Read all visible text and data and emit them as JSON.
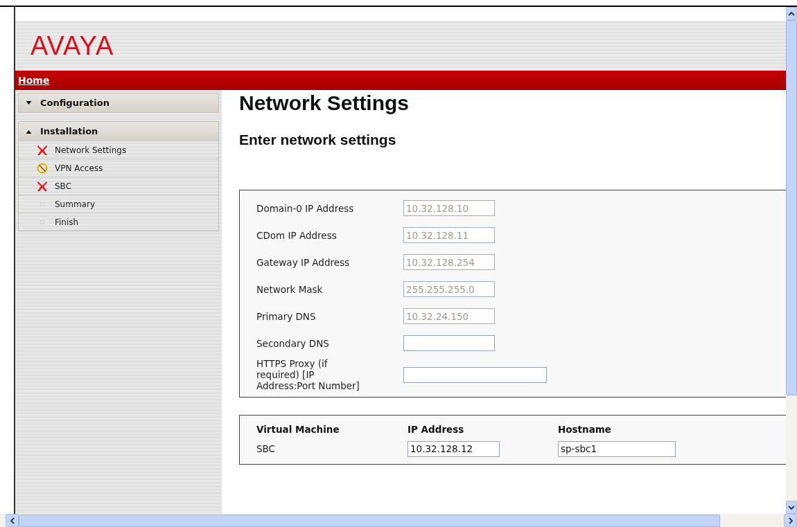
{
  "header": {
    "logo": "AVAYA"
  },
  "nav_bar": {
    "link": "Home"
  },
  "sidebar": {
    "sections": [
      {
        "title": "Configuration",
        "expanded": false
      },
      {
        "title": "Installation",
        "expanded": true,
        "items": [
          {
            "label": "Network Settings",
            "kind": "error"
          },
          {
            "label": "VPN Access",
            "kind": "warning"
          },
          {
            "label": "SBC",
            "kind": "error"
          },
          {
            "label": "Summary",
            "kind": "pending"
          },
          {
            "label": "Finish",
            "kind": "pending"
          }
        ]
      }
    ]
  },
  "title": "Network Settings",
  "subtitle": "Enter network settings",
  "network_form": [
    {
      "label": "Domain-0 IP Address",
      "value": "10.32.128.10",
      "disabled": true
    },
    {
      "label": "CDom IP Address",
      "value": "10.32.128.11",
      "disabled": true
    },
    {
      "label": "Gateway IP Address",
      "value": "10.32.128.254",
      "disabled": true
    },
    {
      "label": "Network Mask",
      "value": "255.255.255.0",
      "disabled": true
    },
    {
      "label": "Primary DNS",
      "value": "10.32.24.150",
      "disabled": true
    },
    {
      "label": "Secondary DNS",
      "disabled": false
    },
    {
      "label": "HTTPS Proxy (if required) [IP Address:Port Number]",
      "disabled": false,
      "wide": true
    }
  ],
  "vm_table": {
    "columns": [
      "Virtual Machine",
      "IP Address",
      "Hostname"
    ],
    "rows": [
      {
        "name": "SBC",
        "ip": "10.32.128.12",
        "hostname": "sp-sbc1"
      }
    ]
  }
}
